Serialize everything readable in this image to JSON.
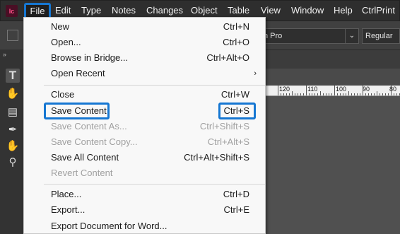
{
  "app_icon": "Ic",
  "menubar": {
    "items": [
      "File",
      "Edit",
      "Type",
      "Notes",
      "Changes",
      "Object",
      "Table",
      "View",
      "Window",
      "Help",
      "CtrlPrint"
    ]
  },
  "controlbar": {
    "font_name": "n Pro",
    "font_style": "Regular"
  },
  "ruler": {
    "labels": [
      "120",
      "110",
      "100",
      "90",
      "80"
    ]
  },
  "file_menu": {
    "new": {
      "label": "New",
      "shortcut": "Ctrl+N"
    },
    "open": {
      "label": "Open...",
      "shortcut": "Ctrl+O"
    },
    "bridge": {
      "label": "Browse in Bridge...",
      "shortcut": "Ctrl+Alt+O"
    },
    "recent": {
      "label": "Open Recent",
      "arrow": "›"
    },
    "close": {
      "label": "Close",
      "shortcut": "Ctrl+W"
    },
    "save_content": {
      "label": "Save Content",
      "shortcut": "Ctrl+S"
    },
    "save_as": {
      "label": "Save Content As...",
      "shortcut": "Ctrl+Shift+S"
    },
    "save_copy": {
      "label": "Save Content Copy...",
      "shortcut": "Ctrl+Alt+S"
    },
    "save_all": {
      "label": "Save All Content",
      "shortcut": "Ctrl+Alt+Shift+S"
    },
    "revert": {
      "label": "Revert Content"
    },
    "place": {
      "label": "Place...",
      "shortcut": "Ctrl+D"
    },
    "export": {
      "label": "Export...",
      "shortcut": "Ctrl+E"
    },
    "export_word": {
      "label": "Export Document for Word..."
    }
  },
  "colors": {
    "highlight": "#1677d2",
    "menu_bg": "#f8f8f8"
  },
  "icons": [
    "type-tool-icon",
    "position-tool-icon",
    "note-tool-icon",
    "eyedropper-icon",
    "hand-icon",
    "zoom-icon",
    "dropdown-chevron-icon",
    "collapse-icon"
  ]
}
